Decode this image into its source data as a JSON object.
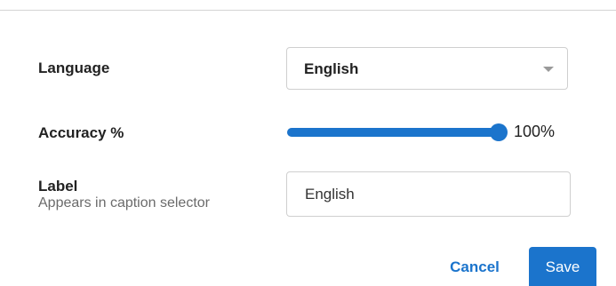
{
  "form": {
    "language": {
      "label": "Language",
      "selected": "English"
    },
    "accuracy": {
      "label": "Accuracy %",
      "value_percent": 100,
      "value_text": "100%"
    },
    "caption_label": {
      "label": "Label",
      "helper": "Appears in caption selector",
      "value": "English"
    }
  },
  "actions": {
    "cancel_label": "Cancel",
    "save_label": "Save"
  },
  "colors": {
    "accent": "#1b74cc",
    "border": "#cfcfcf",
    "helper_text": "#6b6b6b"
  }
}
